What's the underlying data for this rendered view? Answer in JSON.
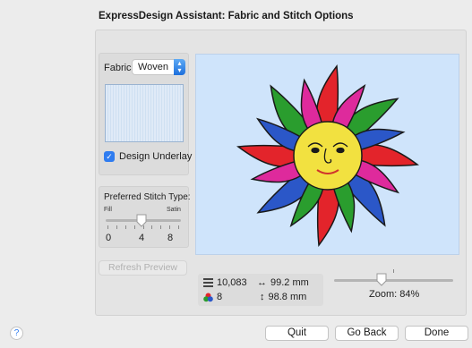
{
  "dialog": {
    "title": "ExpressDesign Assistant: Fabric and Stitch Options"
  },
  "fabric": {
    "label": "Fabric:",
    "selected": "Woven"
  },
  "underlay": {
    "label": "Design Underlay",
    "checked": true
  },
  "stitch": {
    "label": "Preferred Stitch Type:",
    "min_label": "Fill",
    "max_label": "Satin",
    "tick_labels": [
      "0",
      "4",
      "8"
    ],
    "value": 4
  },
  "refresh": {
    "label": "Refresh Preview"
  },
  "stats": {
    "stitches": "10,083",
    "width": "99.2 mm",
    "colors": "8",
    "height": "98.8 mm"
  },
  "zoom": {
    "label": "Zoom: 84%",
    "value_percent": 84
  },
  "buttons": {
    "quit": "Quit",
    "go_back": "Go Back",
    "done": "Done"
  },
  "help": {
    "label": "?"
  },
  "icons": {
    "stitches": "stitch-count-icon",
    "width": "horizontal-arrow-icon",
    "colors": "color-palette-icon",
    "height": "vertical-arrow-icon"
  }
}
